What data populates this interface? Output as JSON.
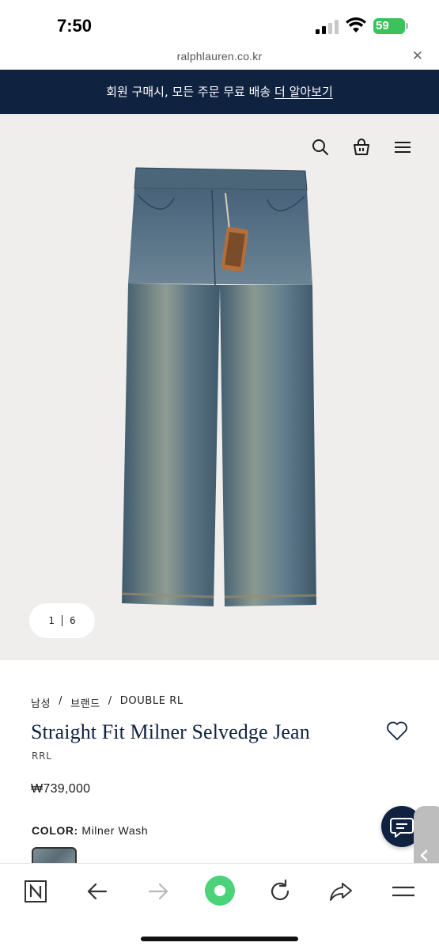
{
  "status_bar": {
    "time": "7:50",
    "battery": "59"
  },
  "url_bar": {
    "domain": "ralphlauren.co.kr",
    "close_icon": "close-icon"
  },
  "promo": {
    "text": "회원 구매시, 모든 주문 무료 배송 ",
    "link": "더 알아보기"
  },
  "header_icons": [
    "search-icon",
    "shopping-bag-icon",
    "hamburger-menu-icon"
  ],
  "gallery": {
    "current": "1",
    "total": "6"
  },
  "breadcrumb": {
    "level1": "남성",
    "level2": "브랜드",
    "level3": "DOUBLE RL",
    "separator": "/"
  },
  "product": {
    "title": "Straight Fit Milner Selvedge Jean",
    "brand": "RRL",
    "price": "₩739,000",
    "color_label": "COLOR:",
    "color_value": "Milner Wash"
  },
  "colors": {
    "navy": "#0f2240",
    "hero_bg": "#efeeec",
    "battery": "#3cc25a",
    "reload_green": "#4cd37a"
  },
  "toolbar": [
    "naver-logo-icon",
    "back-arrow-icon",
    "forward-arrow-icon",
    "green-dot-home-icon",
    "reload-icon",
    "share-icon",
    "menu-icon"
  ]
}
